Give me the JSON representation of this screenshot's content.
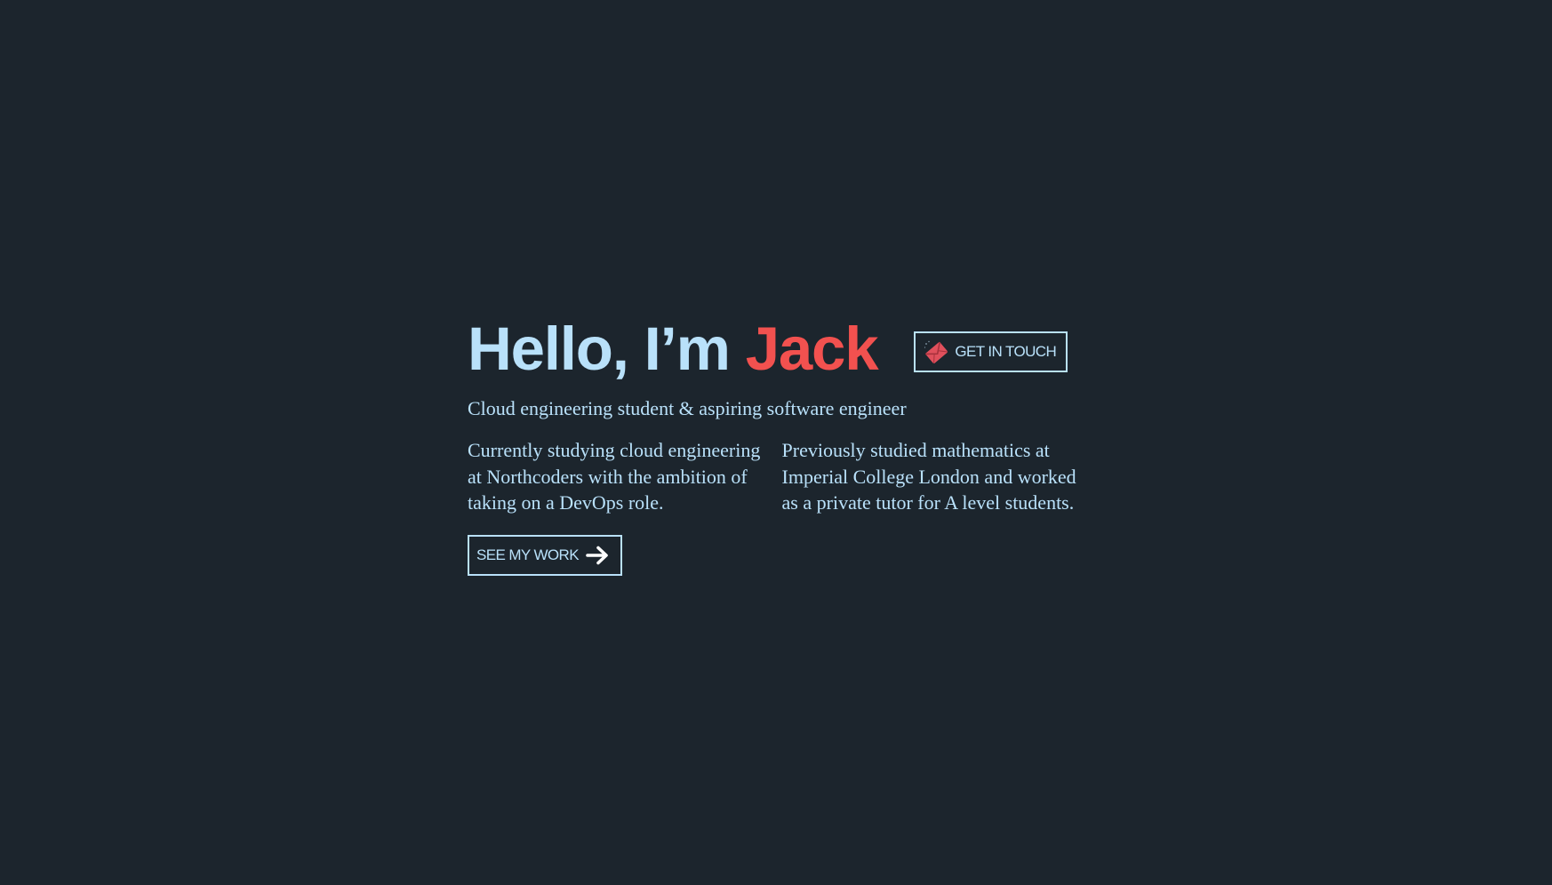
{
  "hero": {
    "greeting": "Hello, I’m ",
    "name": "Jack",
    "contact_label": "GET IN TOUCH",
    "contact_icon": "envelope-icon",
    "tagline": "Cloud engineering student & aspiring software engineer",
    "paragraphs": [
      "Currently studying cloud engineering at Northcoders with the ambition of taking on a DevOps role.",
      "Previously studied mathematics at Imperial College London and worked as a private tutor for A level students."
    ],
    "work_label": "SEE MY WORK",
    "work_icon": "arrow-right-icon"
  },
  "colors": {
    "background": "#1c252d",
    "text": "#b9e1fa",
    "accent": "#f2514f"
  }
}
